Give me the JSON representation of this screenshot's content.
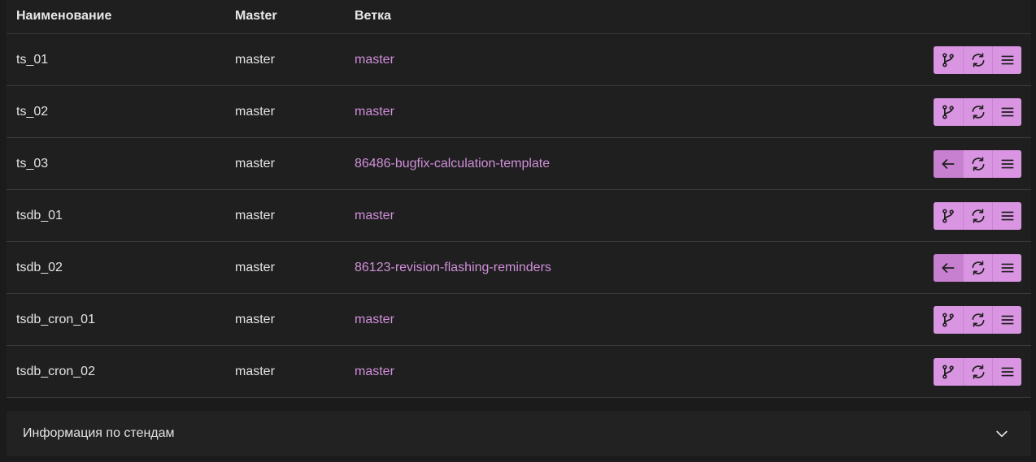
{
  "table": {
    "headers": {
      "name": "Наименование",
      "master": "Master",
      "branch": "Ветка"
    },
    "rows": [
      {
        "name": "ts_01",
        "master": "master",
        "branch": "master",
        "first_action_icon": "branch-icon"
      },
      {
        "name": "ts_02",
        "master": "master",
        "branch": "master",
        "first_action_icon": "branch-icon"
      },
      {
        "name": "ts_03",
        "master": "master",
        "branch": "86486-bugfix-calculation-template",
        "first_action_icon": "arrow-left-icon"
      },
      {
        "name": "tsdb_01",
        "master": "master",
        "branch": "master",
        "first_action_icon": "branch-icon"
      },
      {
        "name": "tsdb_02",
        "master": "master",
        "branch": "86123-revision-flashing-reminders",
        "first_action_icon": "arrow-left-icon"
      },
      {
        "name": "tsdb_cron_01",
        "master": "master",
        "branch": "master",
        "first_action_icon": "branch-icon"
      },
      {
        "name": "tsdb_cron_02",
        "master": "master",
        "branch": "master",
        "first_action_icon": "branch-icon"
      }
    ]
  },
  "panel": {
    "title": "Информация по стендам",
    "icon": "chevron-down-icon"
  },
  "colors": {
    "accent": "#d995e2",
    "accent_dark": "#c77fd0",
    "branch_text": "#d08fd8",
    "background": "#1b1b1b",
    "surface": "#1f1f20"
  }
}
